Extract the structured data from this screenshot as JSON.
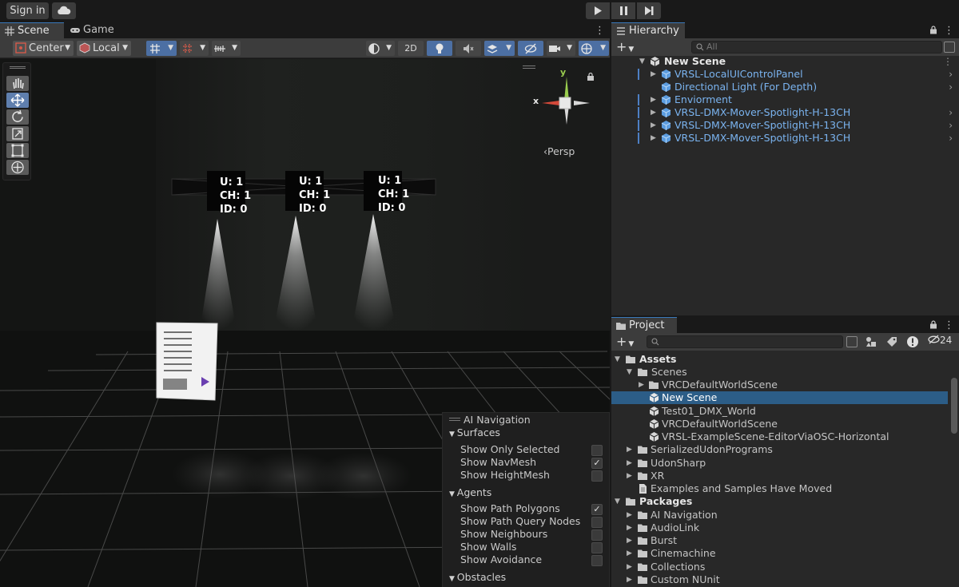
{
  "topbar": {
    "sign_in": "Sign in"
  },
  "scene_panel": {
    "tab_scene": "Scene",
    "tab_game": "Game",
    "pivot_label": "Center",
    "space_label": "Local",
    "mode_2d": "2D",
    "persp_label": "Persp",
    "gizmo_x": "x",
    "gizmo_y": "y"
  },
  "fixtures": [
    {
      "u": "U: 1",
      "ch": "CH: 1",
      "id": "ID: 0"
    },
    {
      "u": "U: 1",
      "ch": "CH: 1",
      "id": "ID: 0"
    },
    {
      "u": "U: 1",
      "ch": "CH: 1",
      "id": "ID: 0"
    }
  ],
  "ai_navigation": {
    "title": "AI Navigation",
    "surfaces": "Surfaces",
    "show_only_selected": "Show Only Selected",
    "show_navmesh": "Show NavMesh",
    "show_heightmesh": "Show HeightMesh",
    "agents": "Agents",
    "show_path_polygons": "Show Path Polygons",
    "show_path_query_nodes": "Show Path Query Nodes",
    "show_neighbours": "Show Neighbours",
    "show_walls": "Show Walls",
    "show_avoidance": "Show Avoidance",
    "obstacles": "Obstacles",
    "checked": {
      "show_navmesh": true,
      "show_path_polygons": true
    }
  },
  "hierarchy": {
    "tab": "Hierarchy",
    "search_placeholder": "All",
    "scene_name": "New Scene",
    "items": [
      "VRSL-LocalUIControlPanel",
      "Directional Light (For Depth)",
      "Enviorment",
      "VRSL-DMX-Mover-Spotlight-H-13CH",
      "VRSL-DMX-Mover-Spotlight-H-13CH",
      "VRSL-DMX-Mover-Spotlight-H-13CH"
    ]
  },
  "project": {
    "tab": "Project",
    "hidden_count": "24",
    "tree": [
      {
        "label": "Assets",
        "kind": "root"
      },
      {
        "label": "Scenes",
        "kind": "folder-open"
      },
      {
        "label": "VRCDefaultWorldScene",
        "kind": "folder"
      },
      {
        "label": "New Scene",
        "kind": "scene"
      },
      {
        "label": "Test01_DMX_World",
        "kind": "scene"
      },
      {
        "label": "VRCDefaultWorldScene",
        "kind": "scene"
      },
      {
        "label": "VRSL-ExampleScene-EditorViaOSC-Horizontal",
        "kind": "scene"
      },
      {
        "label": "SerializedUdonPrograms",
        "kind": "folder"
      },
      {
        "label": "UdonSharp",
        "kind": "folder"
      },
      {
        "label": "XR",
        "kind": "folder"
      },
      {
        "label": "Examples and Samples Have Moved",
        "kind": "doc"
      },
      {
        "label": "Packages",
        "kind": "root"
      },
      {
        "label": "AI Navigation",
        "kind": "folder"
      },
      {
        "label": "AudioLink",
        "kind": "folder"
      },
      {
        "label": "Burst",
        "kind": "folder"
      },
      {
        "label": "Cinemachine",
        "kind": "folder"
      },
      {
        "label": "Collections",
        "kind": "folder"
      },
      {
        "label": "Custom NUnit",
        "kind": "folder"
      }
    ]
  },
  "colors": {
    "selection": "#2c5d87",
    "prefab_text": "#7ab3ef",
    "accent": "#4c6fa3"
  }
}
